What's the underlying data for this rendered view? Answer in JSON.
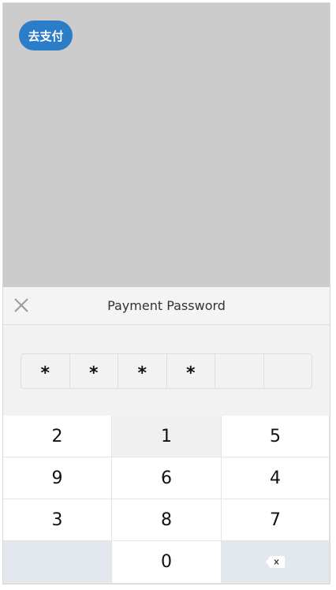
{
  "overlay": {
    "go_pay_label": "去支付"
  },
  "dialog": {
    "title": "Payment Password",
    "close_icon": "close-icon"
  },
  "password": {
    "length": 6,
    "entered_count": 4,
    "mask": [
      "*",
      "*",
      "*",
      "*",
      "",
      ""
    ]
  },
  "keypad": {
    "keys": [
      "2",
      "1",
      "5",
      "9",
      "6",
      "4",
      "3",
      "8",
      "7",
      "",
      "0",
      "⌫"
    ],
    "pressed_key": "1",
    "delete_icon": "backspace-icon"
  },
  "colors": {
    "overlay": "#cccccc",
    "accent": "#2b7dc8",
    "panel": "#f2f2f2",
    "special_key": "#e3e7ee"
  }
}
